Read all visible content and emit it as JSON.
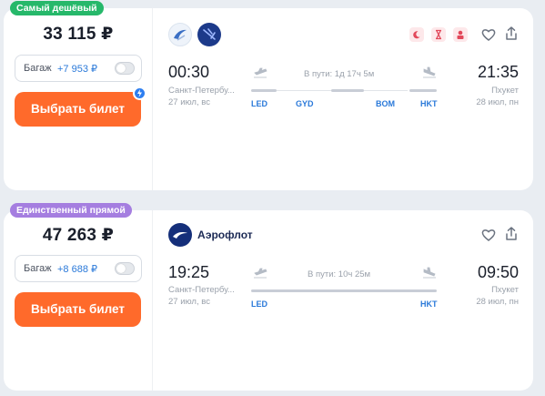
{
  "flights": [
    {
      "badge": "Самый дешёвый",
      "badge_color": "#26b86a",
      "price": "33 115 ₽",
      "baggage_label": "Багаж",
      "baggage_price": "+7 953 ₽",
      "buy_label": "Выбрать билет",
      "airline_logos": [
        "aeroflot-bird-logo",
        "airline-logo-2"
      ],
      "dep_time": "00:30",
      "dep_city": "Санкт-Петербу...",
      "dep_date": "27 июл, вс",
      "duration": "В пути: 1д 17ч 5м",
      "arr_time": "21:35",
      "arr_city": "Пхукет",
      "arr_date": "28 июл, пн",
      "codes": [
        "LED",
        "GYD",
        "BOM",
        "HKT"
      ]
    },
    {
      "badge": "Единственный прямой",
      "badge_color": "#a57ee0",
      "price": "47 263 ₽",
      "baggage_label": "Багаж",
      "baggage_price": "+8 688 ₽",
      "buy_label": "Выбрать билет",
      "airline_name": "Аэрофлот",
      "dep_time": "19:25",
      "dep_city": "Санкт-Петербу...",
      "dep_date": "27 июл, вс",
      "duration": "В пути: 10ч 25м",
      "arr_time": "09:50",
      "arr_city": "Пхукет",
      "arr_date": "28 июл, пн",
      "codes": [
        "LED",
        "HKT"
      ]
    }
  ],
  "colors": {
    "accent_orange": "#ff6a2b",
    "link_blue": "#2a79d9",
    "cheapest_green": "#26b86a",
    "direct_purple": "#a57ee0"
  }
}
